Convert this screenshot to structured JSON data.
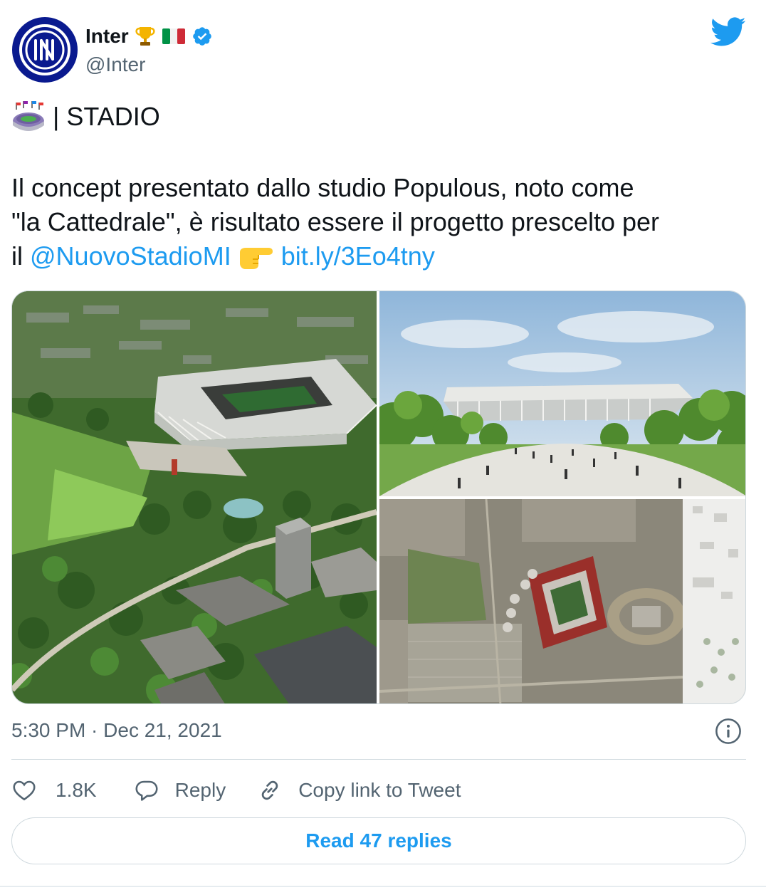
{
  "author": {
    "display_name": "Inter",
    "handle": "@Inter",
    "verified": true,
    "name_emojis": [
      "trophy-emoji",
      "italy-flag-emoji"
    ]
  },
  "tweet": {
    "line1_text": "| STADIO",
    "body_line1": "Il concept presentato dallo studio Populous, noto come",
    "body_line2": "\"la Cattedrale\", è risultato essere il progetto prescelto per",
    "body_line3_prefix": "il",
    "mention": "@NuovoStadioMI",
    "link": "bit.ly/3Eo4tny"
  },
  "media": [
    {
      "name": "aerial-stadium-park-render"
    },
    {
      "name": "stadium-front-plaza-render"
    },
    {
      "name": "satellite-site-map"
    }
  ],
  "meta": {
    "timestamp": "5:30 PM · Dec 21, 2021"
  },
  "actions": {
    "like_count": "1.8K",
    "reply_label": "Reply",
    "copy_label": "Copy link to Tweet"
  },
  "read_replies_label": "Read 47 replies",
  "colors": {
    "accent": "#1d9bf0",
    "text": "#0f1419",
    "secondary": "#536471",
    "border": "#cfd9de",
    "inter_blue": "#0a1a8f"
  },
  "icons": [
    "info-icon",
    "heart-icon",
    "reply-icon",
    "link-icon",
    "twitter-bird-icon",
    "verified-badge-icon"
  ]
}
